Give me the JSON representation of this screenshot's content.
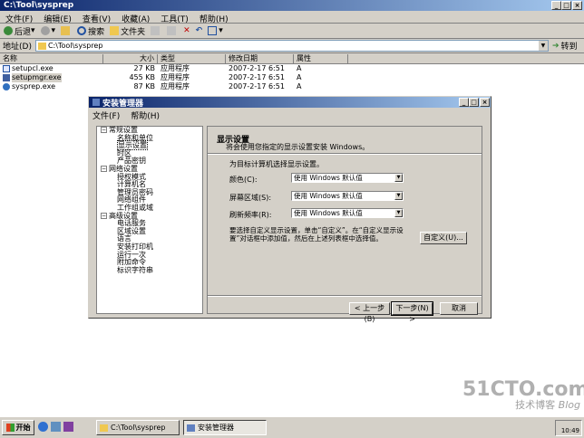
{
  "explorer": {
    "title": "C:\\Tool\\sysprep",
    "menu": [
      "文件(F)",
      "编辑(E)",
      "查看(V)",
      "收藏(A)",
      "工具(T)",
      "帮助(H)"
    ],
    "toolbar": {
      "back": "后退",
      "search": "搜索",
      "folders": "文件夹"
    },
    "address_label": "地址(D)",
    "address_value": "C:\\Tool\\sysprep",
    "go": "转到",
    "columns": [
      "名称",
      "大小",
      "类型",
      "修改日期",
      "属性"
    ],
    "files": [
      {
        "name": "setupcl.exe",
        "size": "27 KB",
        "type": "应用程序",
        "date": "2007-2-17 6:51",
        "attr": "A"
      },
      {
        "name": "setupmgr.exe",
        "size": "455 KB",
        "type": "应用程序",
        "date": "2007-2-17 6:51",
        "attr": "A"
      },
      {
        "name": "sysprep.exe",
        "size": "87 KB",
        "type": "应用程序",
        "date": "2007-2-17 6:51",
        "attr": "A"
      }
    ]
  },
  "dialog": {
    "title": "安装管理器",
    "menu": [
      "文件(F)",
      "帮助(H)"
    ],
    "tree": [
      {
        "label": "常规设置",
        "level": 0,
        "pm": "−"
      },
      {
        "label": "名称和单位",
        "level": 1
      },
      {
        "label": "显示设置",
        "level": 1
      },
      {
        "label": "时区",
        "level": 1
      },
      {
        "label": "产品密钥",
        "level": 1
      },
      {
        "label": "网络设置",
        "level": 0,
        "pm": "−"
      },
      {
        "label": "授权模式",
        "level": 1
      },
      {
        "label": "计算机名",
        "level": 1
      },
      {
        "label": "管理员密码",
        "level": 1
      },
      {
        "label": "网络组件",
        "level": 1
      },
      {
        "label": "工作组或域",
        "level": 1
      },
      {
        "label": "高级设置",
        "level": 0,
        "pm": "−"
      },
      {
        "label": "电话服务",
        "level": 1
      },
      {
        "label": "区域设置",
        "level": 1
      },
      {
        "label": "语言",
        "level": 1
      },
      {
        "label": "安装打印机",
        "level": 1
      },
      {
        "label": "运行一次",
        "level": 1
      },
      {
        "label": "附加命令",
        "level": 1
      },
      {
        "label": "标识字符串",
        "level": 1
      }
    ],
    "heading": "显示设置",
    "subheading": "将会使用您指定的显示设置安装 Windows。",
    "intro": "为目标计算机选择显示设置。",
    "color_label": "颜色(C):",
    "color_value": "使用 Windows 默认值",
    "area_label": "屏幕区域(S):",
    "area_value": "使用 Windows 默认值",
    "refresh_label": "刷新频率(R):",
    "refresh_value": "使用 Windows 默认值",
    "custom_text": "要选择自定义显示设置，单击“自定义”。在“自定义显示设置”对话框中添加值，然后在上述列表框中选择值。",
    "custom_btn": "自定义(U)...",
    "back_btn": "< 上一步(B)",
    "next_btn": "下一步(N) >",
    "cancel_btn": "取消"
  },
  "taskbar": {
    "start": "开始",
    "tasks": [
      "C:\\Tool\\sysprep",
      "安装管理器"
    ],
    "time": "10:49"
  },
  "watermark": {
    "site": "51CTO.com",
    "sub": "技术博客",
    "blog": "Blog"
  }
}
